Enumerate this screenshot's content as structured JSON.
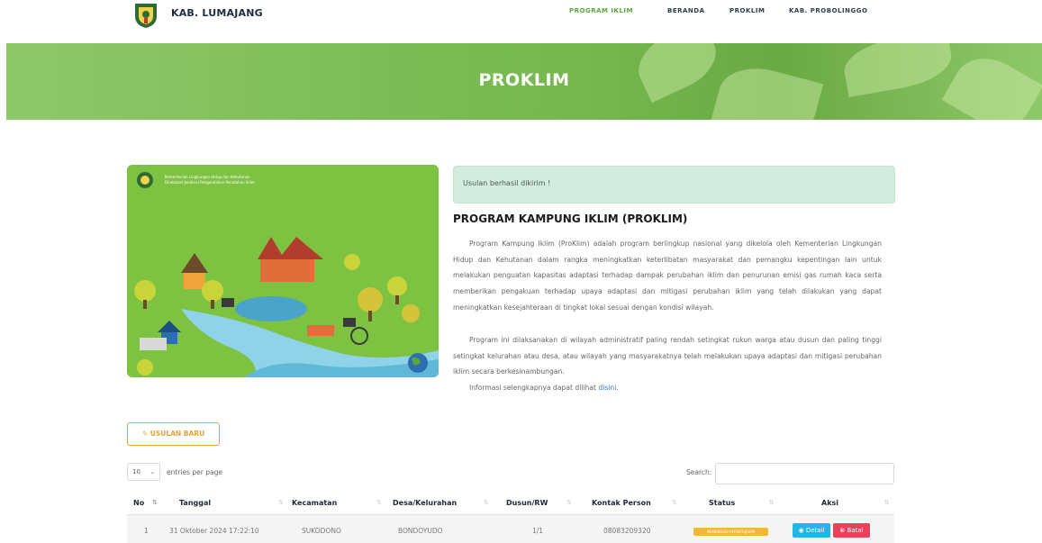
{
  "header": {
    "brand": "KAB. LUMAJANG",
    "nav": [
      "PROGRAM IKLIM",
      "BERANDA",
      "PROKLIM",
      "KAB. PROBOLINGGO"
    ]
  },
  "banner": {
    "title": "PROKLIM"
  },
  "illustration": {
    "header_lines": [
      "Kementerian Lingkungan Hidup dan Kehutanan",
      "Direktorat Jenderal Pengendalian Perubahan Iklim"
    ]
  },
  "alert": {
    "text": "Usulan berhasil dikirim !"
  },
  "program": {
    "title": "PROGRAM KAMPUNG IKLIM (PROKLIM)",
    "p1": "Program Kampung Iklim (ProKlim) adalah program berlingkup nasional yang dikelola oleh Kementerian Lingkungan Hidup dan Kehutanan dalam rangka meningkatkan keterlibatan masyarakat dan pemangku kepentingan lain untuk melakukan penguatan kapasitas adaptasi terhadap dampak perubahan iklim dan penurunan emisi gas rumah kaca serta memberikan pengakuan terhadap upaya adaptasi dan mitigasi perubahan iklim yang telah dilakukan yang dapat meningkatkan kesejahteraan di tingkat lokal sesuai dengan kondisi wilayah.",
    "p2": "Program ini dilaksanakan di wilayah administratif paling rendah setingkat rukun warga atau dusun dan paling tinggi setingkat kelurahan atau desa, atau wilayah yang masyarakatnya telah melakukan upaya adaptasi dan mitigasi perubahan iklim secara berkesinambungan.",
    "p3_prefix": "Informasi selengkapnya dapat dilihat ",
    "p3_link": "disini."
  },
  "actions": {
    "new_button": "USULAN BARU"
  },
  "table_controls": {
    "entries_value": "10",
    "entries_label": "entries per page",
    "search_label": "Search:"
  },
  "table": {
    "columns": [
      "No",
      "Tanggal",
      "Kecamatan",
      "Desa/Kelurahan",
      "Dusun/RW",
      "Kontak Person",
      "Status",
      "Aksi"
    ],
    "rows": [
      {
        "no": "1",
        "tanggal": "31 Oktober 2024 17:22:10",
        "kecamatan": "SUKODONO",
        "desa": "BONDOYUDO",
        "dusun": "1/1",
        "kontak": "08083209320",
        "status": "MENUNGGU PERSETUJUAN",
        "detail": "Detail",
        "batal": "Batal"
      }
    ]
  },
  "colors": {
    "brand_green": "#7dbd57",
    "accent_orange": "#e8a33d",
    "info": "#22b5e6",
    "danger": "#e8415b",
    "warning": "#f3b82d"
  },
  "icons": [
    "lumajang-emblem-icon",
    "edit-icon",
    "eye-icon",
    "close-circle-icon",
    "sort-icon",
    "chevron-down-icon"
  ]
}
